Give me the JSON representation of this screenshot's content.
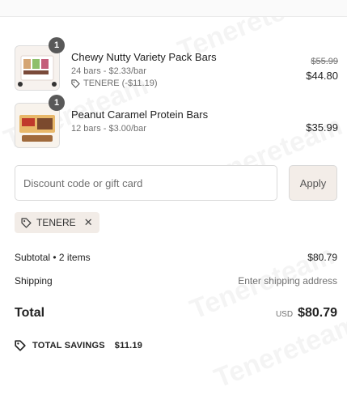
{
  "cart": {
    "items": [
      {
        "quantity": "1",
        "name": "Chewy Nutty Variety Pack Bars",
        "subtitle": "24 bars - $2.33/bar",
        "discount_code": "TENERE (-$11.19)",
        "compare_price": "$55.99",
        "price": "$44.80"
      },
      {
        "quantity": "1",
        "name": "Peanut Caramel Protein Bars",
        "subtitle": "12 bars - $3.00/bar",
        "price": "$35.99"
      }
    ]
  },
  "discount": {
    "placeholder": "Discount code or gift card",
    "apply_label": "Apply",
    "applied_code": "TENERE"
  },
  "summary": {
    "subtotal_label": "Subtotal • 2 items",
    "subtotal_value": "$80.79",
    "shipping_label": "Shipping",
    "shipping_value": "Enter shipping address",
    "total_label": "Total",
    "currency": "USD",
    "total_value": "$80.79",
    "savings_label": "TOTAL SAVINGS",
    "savings_value": "$11.19"
  },
  "watermark": "Tenereteam",
  "colors": {
    "badge": "#595959",
    "chip_bg": "#f2ece7",
    "apply_bg": "#f3ede8",
    "border": "#d9d9d9",
    "muted_text": "#707070"
  }
}
